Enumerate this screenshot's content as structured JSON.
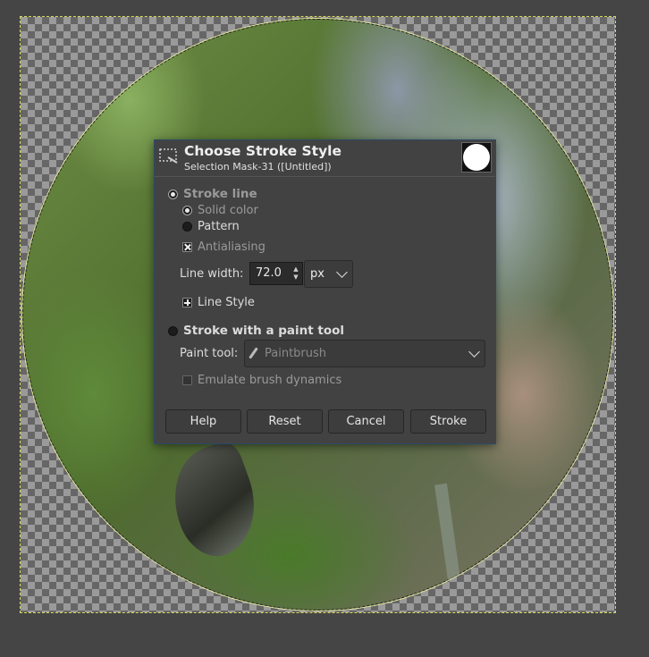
{
  "dialog": {
    "title": "Choose Stroke Style",
    "subtitle": "Selection Mask-31 ([Untitled])",
    "stroke_line": {
      "label": "Stroke line",
      "selected": true,
      "solid_color": "Solid color",
      "pattern": "Pattern",
      "antialiasing": "Antialiasing",
      "line_width_label": "Line width:",
      "line_width_value": "72.0",
      "unit": "px",
      "line_style": "Line Style"
    },
    "paint_tool": {
      "label": "Stroke with a paint tool",
      "selected": false,
      "tool_label": "Paint tool:",
      "tool_value": "Paintbrush",
      "emulate": "Emulate brush dynamics"
    },
    "buttons": {
      "help": "Help",
      "reset": "Reset",
      "cancel": "Cancel",
      "stroke": "Stroke"
    }
  },
  "icons": [
    "stroke-dialog-icon",
    "selection-preview-icon",
    "paintbrush-icon",
    "chevron-down-icon",
    "spin-arrows-icon"
  ],
  "colors": {
    "background": "#454545",
    "dialog": "#424242",
    "selection_marquee": "#d8d860"
  }
}
